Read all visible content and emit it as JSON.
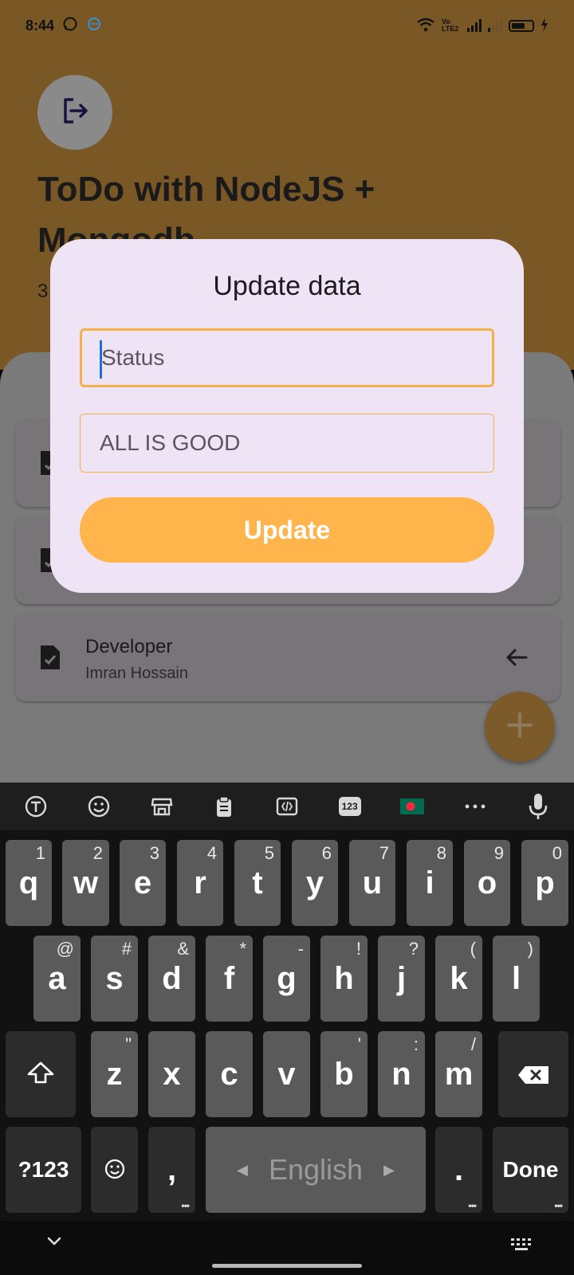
{
  "status_bar": {
    "time": "8:44",
    "network_label": "Vo LTE2"
  },
  "app": {
    "title": "ToDo with NodeJS + Mongodb",
    "count_text": "3",
    "items": [
      {
        "title": "",
        "subtitle": ""
      },
      {
        "title": "",
        "subtitle": ""
      },
      {
        "title": "Developer",
        "subtitle": "Imran Hossain"
      }
    ]
  },
  "dialog": {
    "title": "Update data",
    "status_placeholder": "Status",
    "description_value": "ALL IS GOOD",
    "update_label": "Update"
  },
  "keyboard": {
    "toolbar_icons": [
      "translate-icon",
      "emoji-icon",
      "store-icon",
      "clipboard-icon",
      "text-edit-icon",
      "numbers-icon",
      "flag-icon",
      "more-icon",
      "mic-icon"
    ],
    "toolbar_numbers_label": "123",
    "row1": [
      {
        "key": "q",
        "hint": "1"
      },
      {
        "key": "w",
        "hint": "2"
      },
      {
        "key": "e",
        "hint": "3"
      },
      {
        "key": "r",
        "hint": "4"
      },
      {
        "key": "t",
        "hint": "5"
      },
      {
        "key": "y",
        "hint": "6"
      },
      {
        "key": "u",
        "hint": "7"
      },
      {
        "key": "i",
        "hint": "8"
      },
      {
        "key": "o",
        "hint": "9"
      },
      {
        "key": "p",
        "hint": "0"
      }
    ],
    "row2": [
      {
        "key": "a",
        "hint": "@"
      },
      {
        "key": "s",
        "hint": "#"
      },
      {
        "key": "d",
        "hint": "&"
      },
      {
        "key": "f",
        "hint": "*"
      },
      {
        "key": "g",
        "hint": "-"
      },
      {
        "key": "h",
        "hint": "!"
      },
      {
        "key": "j",
        "hint": "?"
      },
      {
        "key": "k",
        "hint": "("
      },
      {
        "key": "l",
        "hint": ")"
      }
    ],
    "row3": [
      {
        "key": "z",
        "hint": "\""
      },
      {
        "key": "x",
        "hint": ""
      },
      {
        "key": "c",
        "hint": ""
      },
      {
        "key": "v",
        "hint": ""
      },
      {
        "key": "b",
        "hint": "'"
      },
      {
        "key": "n",
        "hint": ":"
      },
      {
        "key": "m",
        "hint": "/"
      }
    ],
    "symbols_label": "?123",
    "comma_label": ",",
    "space_label": "English",
    "period_label": ".",
    "done_label": "Done"
  },
  "colors": {
    "accent": "#ffb54c",
    "dialog_bg": "#efe4f5",
    "caret": "#1e6fd9"
  }
}
